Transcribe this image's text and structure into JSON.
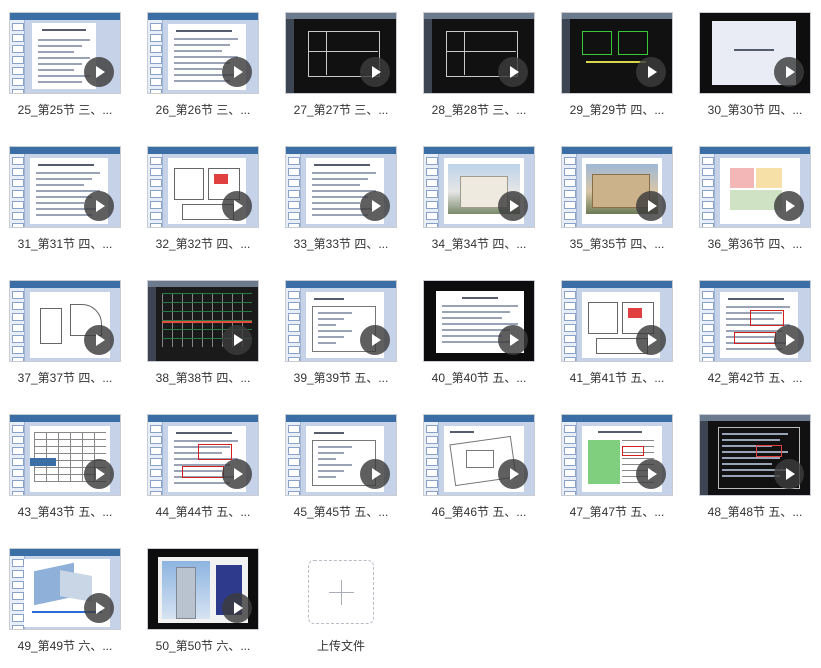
{
  "videos": [
    {
      "caption": "25_第25节 三、...",
      "kind": "doc"
    },
    {
      "caption": "26_第26节 三、...",
      "kind": "ppt-text"
    },
    {
      "caption": "27_第27节 三、...",
      "kind": "cad"
    },
    {
      "caption": "28_第28节 三、...",
      "kind": "cad"
    },
    {
      "caption": "29_第29节 四、...",
      "kind": "cad-green"
    },
    {
      "caption": "30_第30节 四、...",
      "kind": "ppt-title"
    },
    {
      "caption": "31_第31节 四、...",
      "kind": "ppt-text"
    },
    {
      "caption": "32_第32节 四、...",
      "kind": "ppt-plan"
    },
    {
      "caption": "33_第33节 四、...",
      "kind": "ppt-text"
    },
    {
      "caption": "34_第34节 四、...",
      "kind": "ppt-photo"
    },
    {
      "caption": "35_第35节 四、...",
      "kind": "ppt-photo2"
    },
    {
      "caption": "36_第36节 四、...",
      "kind": "ppt-colorplan"
    },
    {
      "caption": "37_第37节 四、...",
      "kind": "ppt-drawing"
    },
    {
      "caption": "38_第38节 四、...",
      "kind": "cad-plan"
    },
    {
      "caption": "39_第39节 五、...",
      "kind": "ppt-list"
    },
    {
      "caption": "40_第40节 五、...",
      "kind": "ppt-black"
    },
    {
      "caption": "41_第41节 五、...",
      "kind": "ppt-plan"
    },
    {
      "caption": "42_第42节 五、...",
      "kind": "ppt-text-red"
    },
    {
      "caption": "43_第43节 五、...",
      "kind": "ppt-table"
    },
    {
      "caption": "44_第44节 五、...",
      "kind": "ppt-text-red"
    },
    {
      "caption": "45_第45节 五、...",
      "kind": "ppt-list"
    },
    {
      "caption": "46_第46节 五、...",
      "kind": "ppt-sitemap"
    },
    {
      "caption": "47_第47节 五、...",
      "kind": "ppt-green"
    },
    {
      "caption": "48_第48节 五、...",
      "kind": "cad-text"
    },
    {
      "caption": "49_第49节 六、...",
      "kind": "ppt-3d"
    },
    {
      "caption": "50_第50节 六、...",
      "kind": "ppt-building"
    }
  ],
  "upload": {
    "label": "上传文件"
  },
  "colors": {
    "play_bg": "#3c3c3c",
    "caption": "#333333",
    "ppt_blue": "#3a6ea5"
  }
}
